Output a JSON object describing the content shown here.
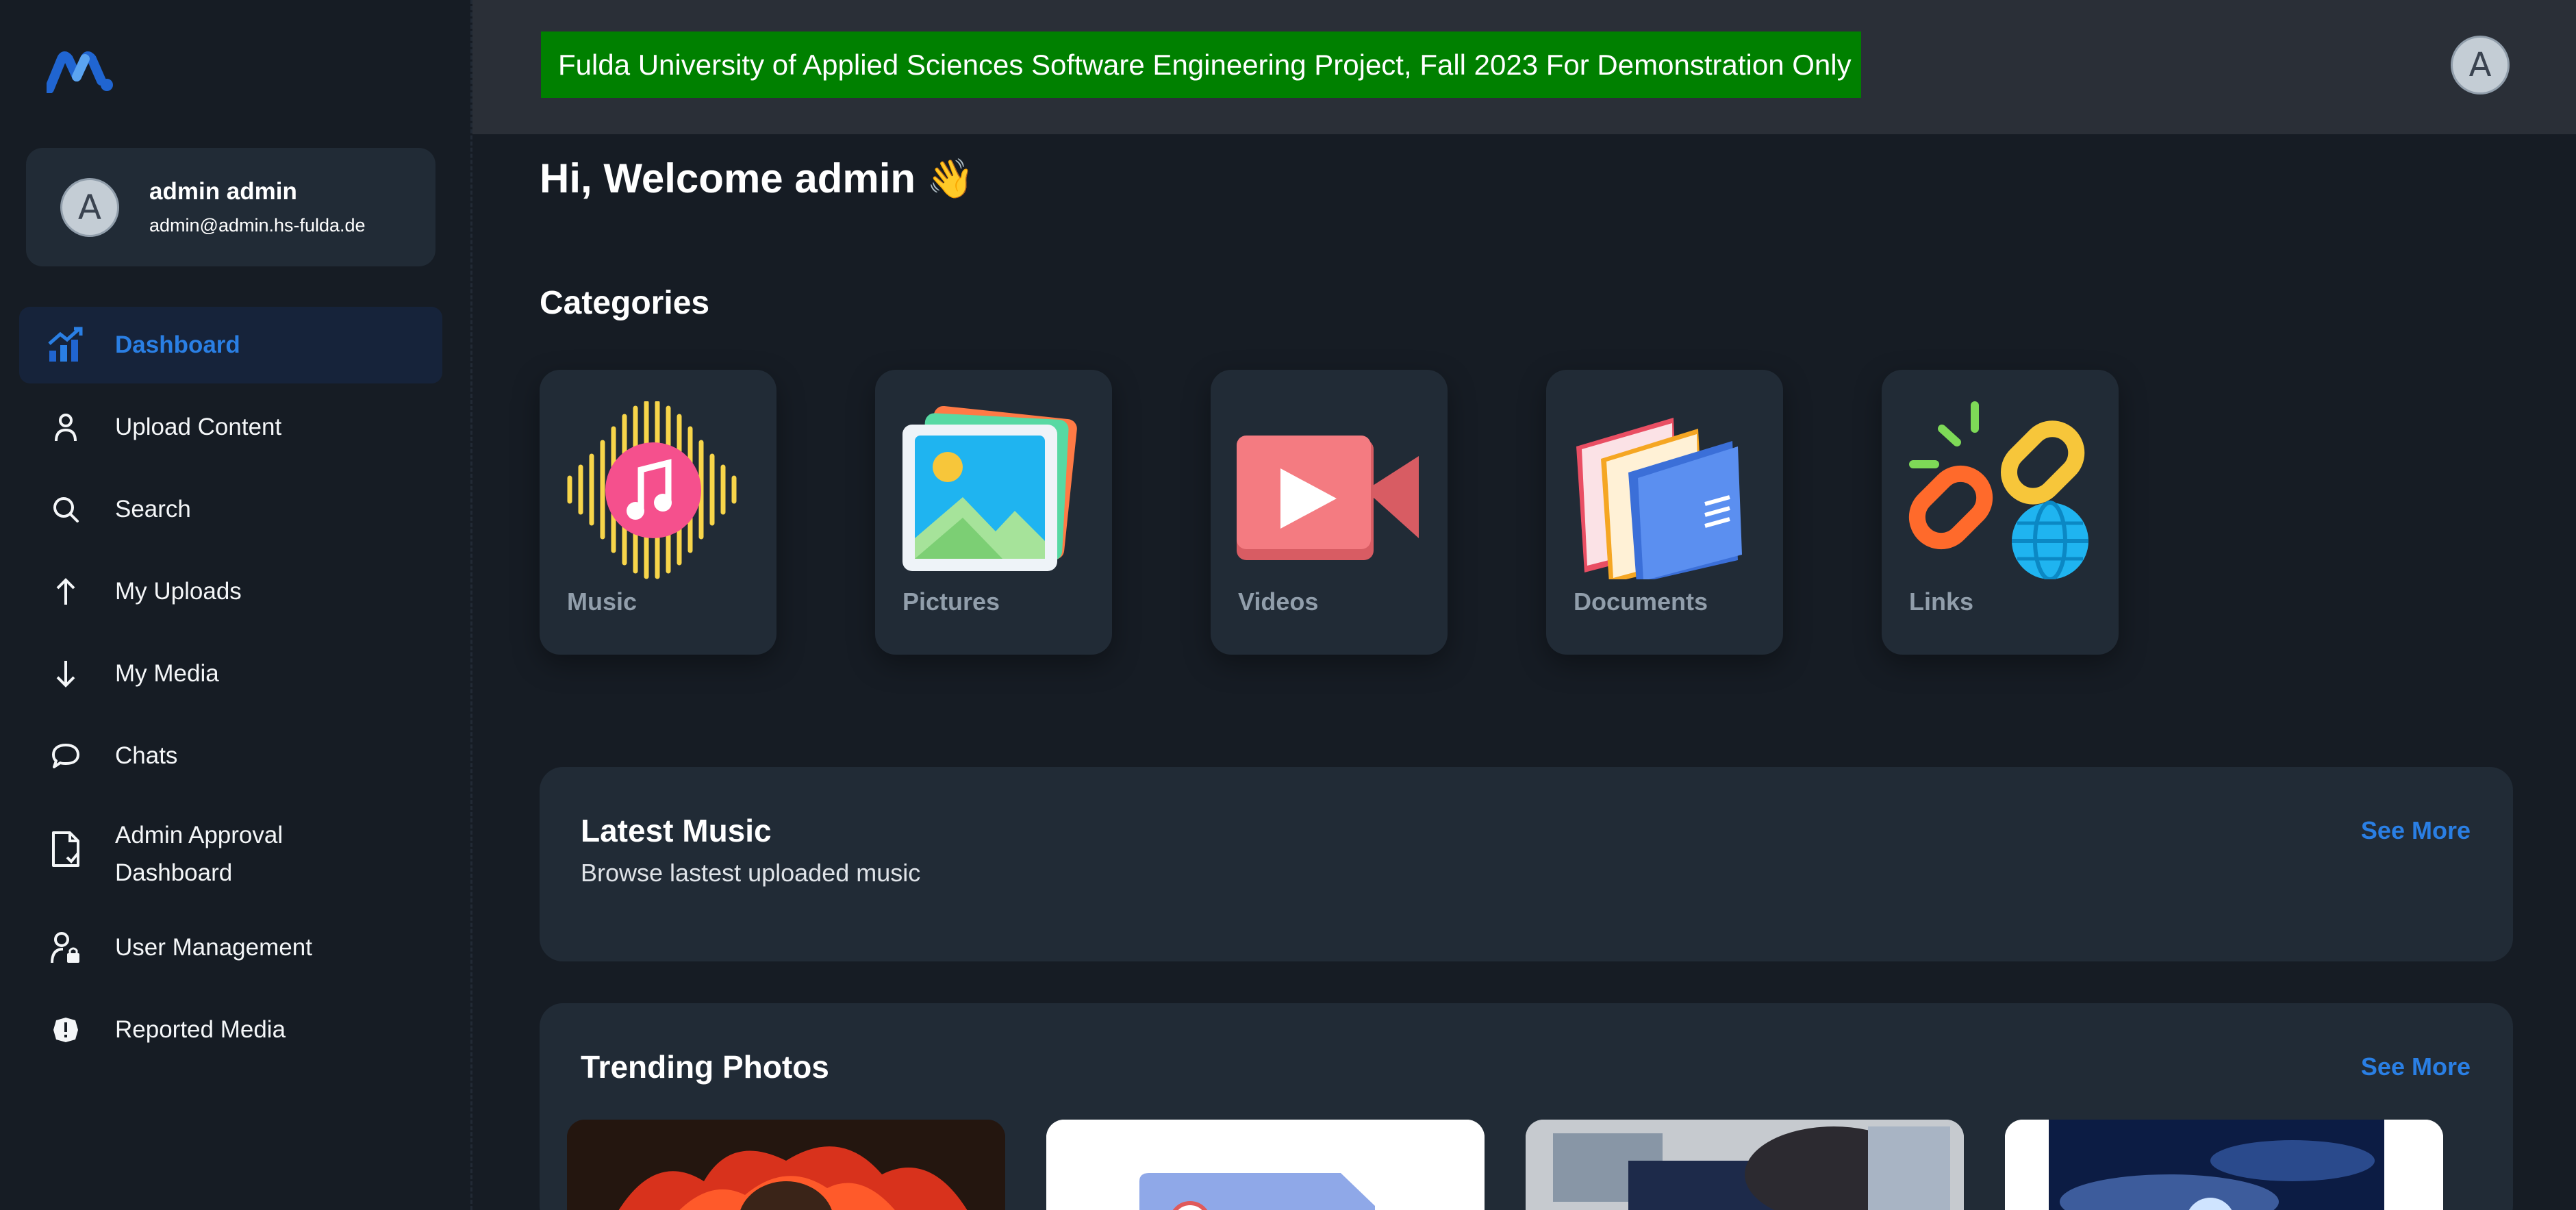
{
  "header": {
    "banner_text": "Fulda University of Applied Sciences Software Engineering Project, Fall 2023 For Demonstration Only",
    "avatar_letter": "A"
  },
  "account": {
    "avatar_letter": "A",
    "name": "admin admin",
    "email": "admin@admin.hs-fulda.de"
  },
  "sidebar": {
    "items": [
      {
        "label": "Dashboard",
        "icon": "dashboard-chart-icon",
        "active": true
      },
      {
        "label": "Upload Content",
        "icon": "user-icon"
      },
      {
        "label": "Search",
        "icon": "search-icon"
      },
      {
        "label": "My Uploads",
        "icon": "arrow-up-icon"
      },
      {
        "label": "My Media",
        "icon": "arrow-down-icon"
      },
      {
        "label": "Chats",
        "icon": "chat-bubble-icon"
      },
      {
        "label": "Admin Approval\nDashboard",
        "icon": "document-check-icon"
      },
      {
        "label": "User Management",
        "icon": "user-lock-icon"
      },
      {
        "label": "Reported Media",
        "icon": "alert-icon"
      }
    ]
  },
  "main": {
    "welcome": "Hi, Welcome admin",
    "wave_emoji": "👋",
    "categories_title": "Categories",
    "categories": [
      {
        "label": "Music",
        "icon": "music-icon"
      },
      {
        "label": "Pictures",
        "icon": "pictures-icon"
      },
      {
        "label": "Videos",
        "icon": "video-icon"
      },
      {
        "label": "Documents",
        "icon": "documents-icon"
      },
      {
        "label": "Links",
        "icon": "links-icon"
      }
    ],
    "latest_music": {
      "title": "Latest Music",
      "subtitle": "Browse lastest uploaded music",
      "see_more": "See More"
    },
    "trending_photos": {
      "title": "Trending Photos",
      "see_more": "See More"
    }
  },
  "colors": {
    "background": "#161c24",
    "card": "#212b36",
    "accent": "#2a7fe4",
    "banner": "#008000",
    "muted_text": "#919eab"
  }
}
